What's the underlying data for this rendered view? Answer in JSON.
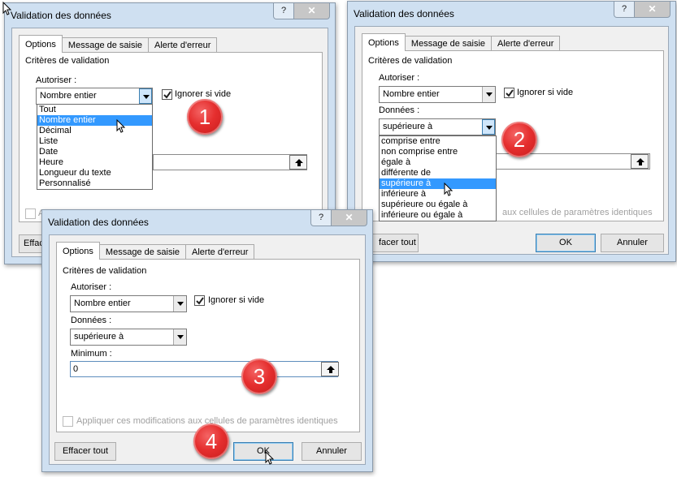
{
  "dialog_title": "Validation des données",
  "tabs": [
    "Options",
    "Message de saisie",
    "Alerte d'erreur"
  ],
  "criteria_label": "Critères de validation",
  "allow_label": "Autoriser :",
  "allow_value": "Nombre entier",
  "ignore_blank_label": "Ignorer si vide",
  "data_label": "Données :",
  "data_value": "supérieure à",
  "minimum_label": "Minimum :",
  "minimum_value": "0",
  "apply_label": "Appliquer ces modifications aux cellules de paramètres identiques",
  "apply_label_tail": "aux cellules de paramètres identiques",
  "clear_all": "Effacer tout",
  "clear_all_clipped": "Effac",
  "clear_all_tail": "facer tout",
  "ok": "OK",
  "cancel": "Annuler",
  "allow_options": [
    "Tout",
    "Nombre entier",
    "Décimal",
    "Liste",
    "Date",
    "Heure",
    "Longueur du texte",
    "Personnalisé"
  ],
  "allow_selected_index": 1,
  "data_options": [
    "comprise entre",
    "non comprise entre",
    "égale à",
    "différente de",
    "supérieure à",
    "inférieure à",
    "supérieure ou égale à",
    "inférieure ou égale à"
  ],
  "data_selected_index": 4,
  "step_markers": [
    "1",
    "2",
    "3",
    "4"
  ],
  "icons": {
    "help": "question-mark-icon",
    "close": "close-x-icon",
    "dropdown": "chevron-down-icon",
    "range": "collapse-range-icon",
    "cursor": "mouse-pointer-icon"
  },
  "colors": {
    "selection": "#3399ff",
    "marker": "#e52e2e",
    "frame": "#cfe0f1"
  }
}
